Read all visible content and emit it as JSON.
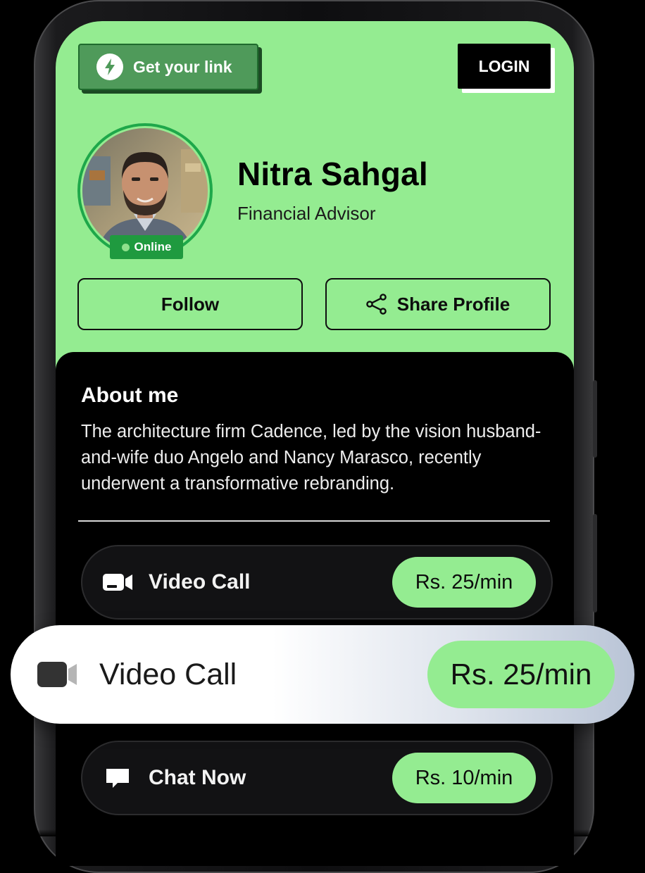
{
  "header": {
    "get_link_label": "Get your link",
    "login_label": "LOGIN"
  },
  "profile": {
    "name": "Nitra Sahgal",
    "role": "Financial Advisor",
    "status": "Online",
    "follow_label": "Follow",
    "share_label": "Share Profile"
  },
  "about": {
    "title": "About me",
    "text": "The architecture firm Cadence, led by the vision husband-and-wife duo Angelo and Nancy Marasco, recently underwent a transformative rebranding."
  },
  "services": [
    {
      "label": "Video Call",
      "price": "Rs. 25/min",
      "icon": "video-camera-icon"
    },
    {
      "label": "Chat Now",
      "price": "Rs. 10/min",
      "icon": "chat-bubble-icon"
    }
  ],
  "highlight": {
    "label": "Video Call",
    "price": "Rs. 25/min",
    "icon": "video-camera-icon"
  },
  "colors": {
    "brand_green": "#94ec91",
    "dark_green": "#1f9a3f",
    "button_green": "#4f9a5a",
    "background": "#000000",
    "card_surface": "#121214"
  }
}
